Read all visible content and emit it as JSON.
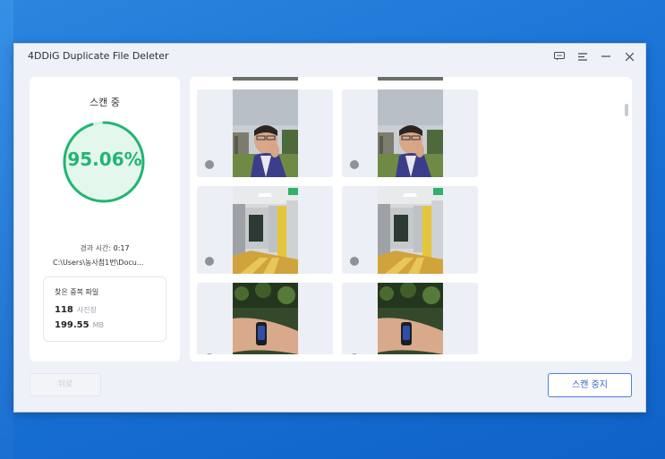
{
  "window": {
    "title": "4DDiG Duplicate File Deleter",
    "controls": [
      "feedback-icon",
      "menu-icon",
      "minimize-icon",
      "close-icon"
    ]
  },
  "scan": {
    "status_label": "스캔 중",
    "percent_text": "95.06%",
    "progress": 0.9506,
    "elapsed_label": "경과 시간:",
    "elapsed_value": "0:17",
    "current_path": "C:\\Users\\농사첨1번\\Docu..."
  },
  "found": {
    "title": "찾은 중복 파일",
    "count": "118",
    "count_unit": "사진장",
    "size": "199.55",
    "size_unit": "MB"
  },
  "thumbnails": [
    {
      "subject": "man-portrait"
    },
    {
      "subject": "man-portrait"
    },
    {
      "subject": "station-corridor"
    },
    {
      "subject": "station-corridor"
    },
    {
      "subject": "wrist-band"
    },
    {
      "subject": "wrist-band"
    }
  ],
  "buttons": {
    "undo": "뒤로",
    "stop_scan": "스캔 중지"
  },
  "colors": {
    "accent_green": "#22b573",
    "accent_blue": "#2f63c9"
  }
}
